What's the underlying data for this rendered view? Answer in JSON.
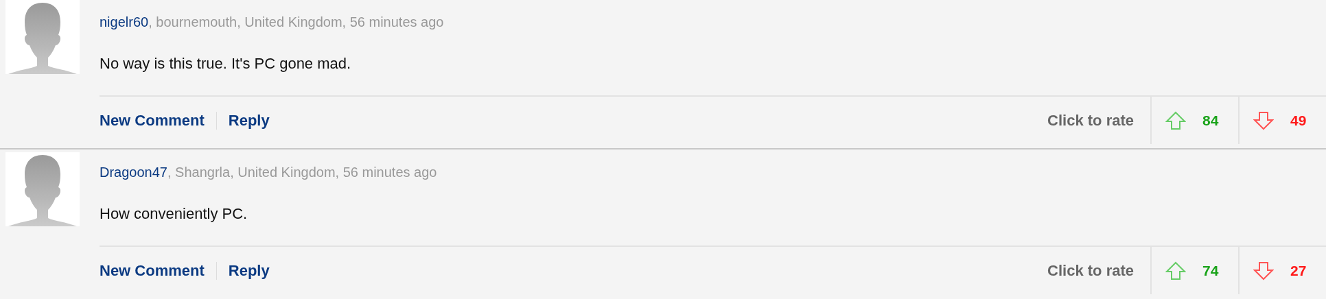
{
  "comments": [
    {
      "author": "nigelr60",
      "meta": ", bournemouth, United Kingdom, 56 minutes ago",
      "text": "No way is this true. It's PC gone mad.",
      "actions": [
        "New Comment",
        "Reply"
      ],
      "rate_label": "Click to rate",
      "up_count": "84",
      "down_count": "49"
    },
    {
      "author": "Dragoon47",
      "meta": ", Shangrla, United Kingdom, 56 minutes ago",
      "text": "How conveniently PC.",
      "actions": [
        "New Comment",
        "Reply"
      ],
      "rate_label": "Click to rate",
      "up_count": "74",
      "down_count": "27"
    }
  ]
}
